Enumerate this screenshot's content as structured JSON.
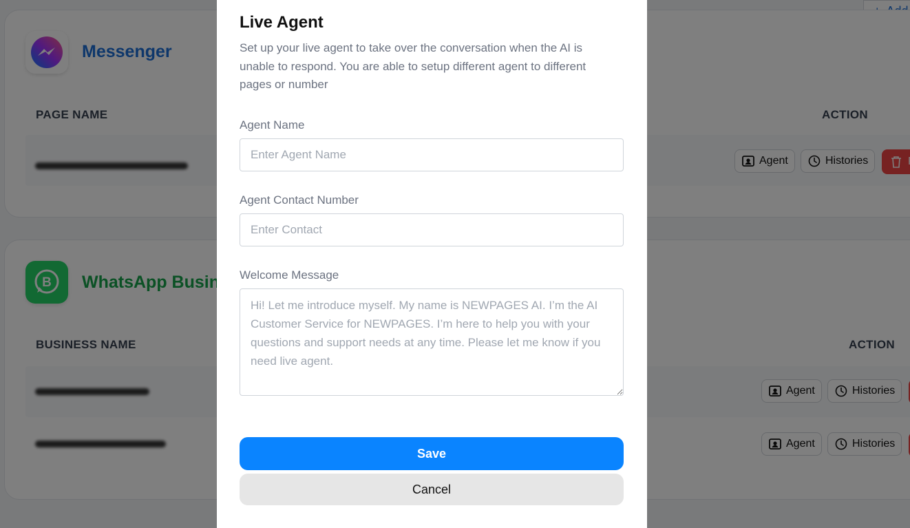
{
  "header": {
    "add_label": "Add"
  },
  "messenger": {
    "title": "Messenger",
    "title_color": "#1d6fd6",
    "icon": "messenger-icon",
    "col_page_name": "PAGE NAME",
    "col_action": "ACTION",
    "row": {
      "agent_label": "Agent",
      "histories_label": "Histories",
      "delete_label": "R"
    }
  },
  "whatsapp": {
    "title": "WhatsApp Busine",
    "title_color": "#16a34a",
    "icon": "whatsapp-business-icon",
    "col_business_name": "BUSINESS NAME",
    "col_action": "ACTION",
    "rows": [
      {
        "agent_label": "Agent",
        "histories_label": "Histories"
      },
      {
        "agent_label": "Agent",
        "histories_label": "Histories"
      }
    ]
  },
  "modal": {
    "title": "Live Agent",
    "description": "Set up your live agent to take over the conversation when the AI is unable to respond. You are able to setup different agent to different pages or number",
    "agent_name_label": "Agent Name",
    "agent_name_placeholder": "Enter Agent Name",
    "agent_name_value": "",
    "contact_label": "Agent Contact Number",
    "contact_placeholder": "Enter Contact",
    "contact_value": "",
    "welcome_label": "Welcome Message",
    "welcome_placeholder": "Hi! Let me introduce myself. My name is NEWPAGES AI. I’m the AI Customer Service for NEWPAGES. I’m here to help you with your questions and support needs at any time. Please let me know if you need live agent.",
    "welcome_value": "",
    "save_label": "Save",
    "cancel_label": "Cancel",
    "save_color": "#0a84ff"
  }
}
